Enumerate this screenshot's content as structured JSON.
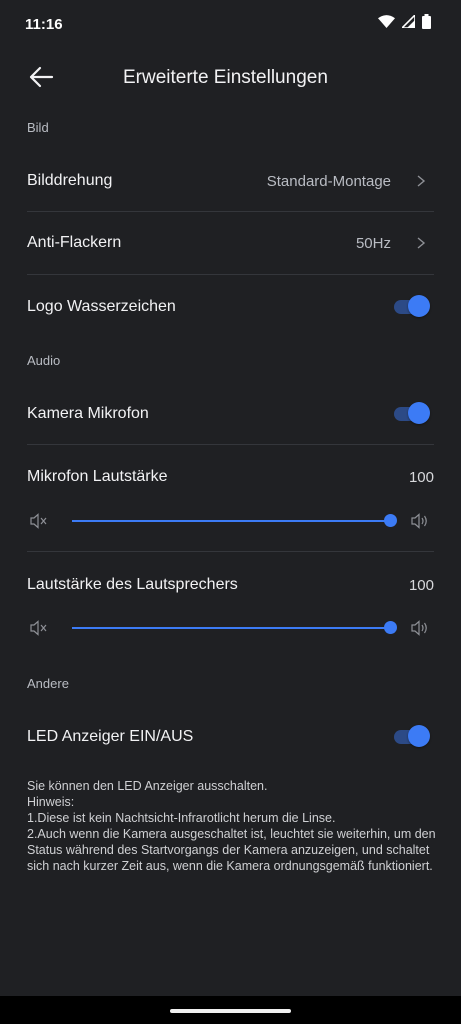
{
  "status": {
    "time": "11:16"
  },
  "header": {
    "title": "Erweiterte Einstellungen"
  },
  "sections": {
    "bild": "Bild",
    "audio": "Audio",
    "andere": "Andere"
  },
  "bild": {
    "rotation_label": "Bilddrehung",
    "rotation_value": "Standard-Montage",
    "flicker_label": "Anti-Flackern",
    "flicker_value": "50Hz",
    "watermark_label": "Logo Wasserzeichen",
    "watermark_on": true
  },
  "audio": {
    "mic_label": "Kamera Mikrofon",
    "mic_on": true,
    "mic_volume_label": "Mikrofon Lautstärke",
    "mic_volume_value": "100",
    "mic_volume_level": 1.0,
    "speaker_volume_label": "Lautstärke des Lautsprechers",
    "speaker_volume_value": "100",
    "speaker_volume_level": 1.0
  },
  "andere": {
    "led_label": "LED Anzeiger EIN/AUS",
    "led_on": true,
    "note": "Sie können den LED Anzeiger ausschalten.\nHinweis:\n1.Diese ist kein Nachtsicht-Infrarotlicht herum die Linse.\n2.Auch wenn die Kamera ausgeschaltet ist, leuchtet sie weiterhin, um den Status während des Startvorgangs der Kamera anzuzeigen, und schaltet sich nach kurzer Zeit aus, wenn die Kamera ordnungsgemäß funktioniert."
  },
  "colors": {
    "accent": "#3c7bf5",
    "background": "#1f2023"
  },
  "icons": {
    "back": "arrow-left-icon",
    "chevron": "chevron-right-icon",
    "mute": "speaker-mute-icon",
    "volume": "speaker-volume-icon"
  }
}
